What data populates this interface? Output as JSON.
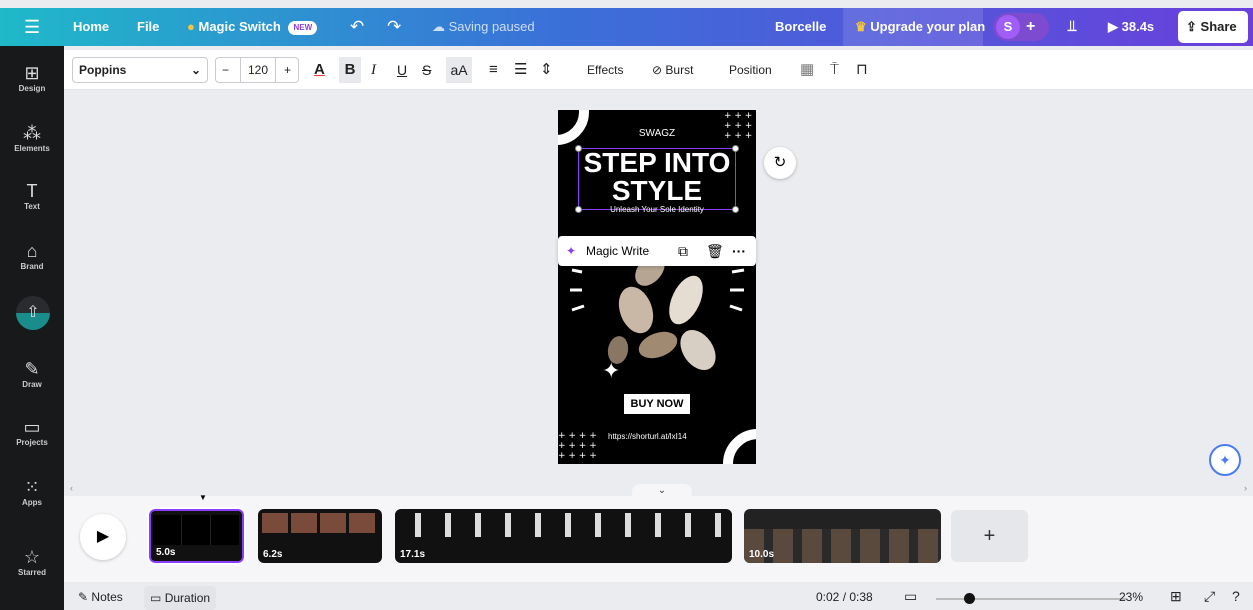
{
  "topbar": {
    "home": "Home",
    "file": "File",
    "magic_switch": "Magic Switch",
    "new_badge": "NEW",
    "saving": "Saving paused",
    "brand": "Borcelle",
    "upgrade": "Upgrade your plan",
    "avatar": "S",
    "play_time": "38.4s",
    "share": "Share"
  },
  "toolbar": {
    "font": "Poppins",
    "font_size": "120",
    "minus": "−",
    "plus": "+",
    "case": "aA",
    "effects": "Effects",
    "burst": "Burst",
    "position": "Position"
  },
  "sidebar": {
    "items": [
      {
        "label": "Design",
        "icon": "design-icon"
      },
      {
        "label": "Elements",
        "icon": "elements-icon"
      },
      {
        "label": "Text",
        "icon": "text-icon"
      },
      {
        "label": "Brand",
        "icon": "brand-icon"
      },
      {
        "label": "",
        "icon": "upload-icon"
      },
      {
        "label": "Draw",
        "icon": "draw-icon"
      },
      {
        "label": "Projects",
        "icon": "projects-icon"
      },
      {
        "label": "Apps",
        "icon": "apps-icon"
      },
      {
        "label": "Starred",
        "icon": "star-icon"
      }
    ]
  },
  "design": {
    "brand": "SWAGZ",
    "title_line1": "STEP INTO",
    "title_line2": "STYLE",
    "subtitle": "Unleash Your Sole Identity",
    "cta": "BUY NOW",
    "url": "https://shorturl.at/lxI14"
  },
  "context_menu": {
    "magic_write": "Magic Write"
  },
  "timeline": {
    "clips": [
      {
        "duration": "5.0s"
      },
      {
        "duration": "6.2s"
      },
      {
        "duration": "17.1s"
      },
      {
        "duration": "10.0s"
      }
    ],
    "add": "+"
  },
  "bottombar": {
    "notes": "Notes",
    "duration": "Duration",
    "time": "0:02 / 0:38",
    "zoom": "23%"
  },
  "colors": {
    "accent": "#8b3dff",
    "sidebar": "#18191b",
    "topbar_start": "#1fb9c9",
    "topbar_end": "#6a3fdc"
  }
}
